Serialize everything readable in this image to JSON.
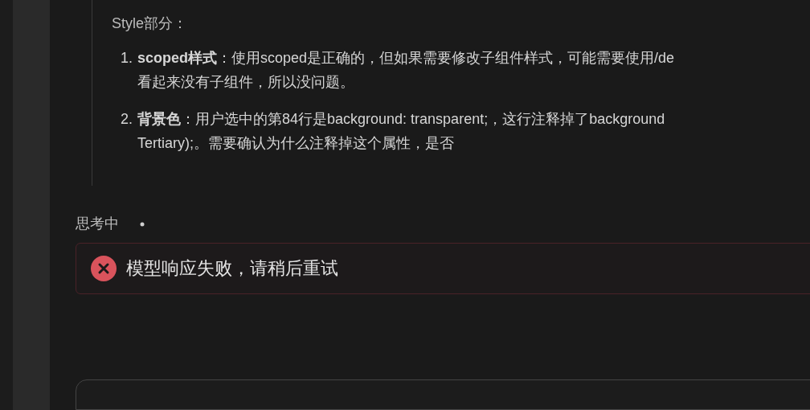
{
  "quote": {
    "heading": "Style部分：",
    "items": [
      {
        "number": "1.",
        "lines": [
          "**scoped样式**：使用scoped是正确的，但如果需要修改子组件样式，可能需要使用/de",
          "看起来没有子组件，所以没问题。"
        ]
      },
      {
        "number": "2.",
        "lines": [
          "**背景色**：用户选中的第84行是background: transparent;，这行注释掉了background",
          "Tertiary);。需要确认为什么注释掉这个属性，是否"
        ]
      }
    ]
  },
  "status": {
    "label": "思考中"
  },
  "error": {
    "message": "模型响应失败，请稍后重试"
  }
}
